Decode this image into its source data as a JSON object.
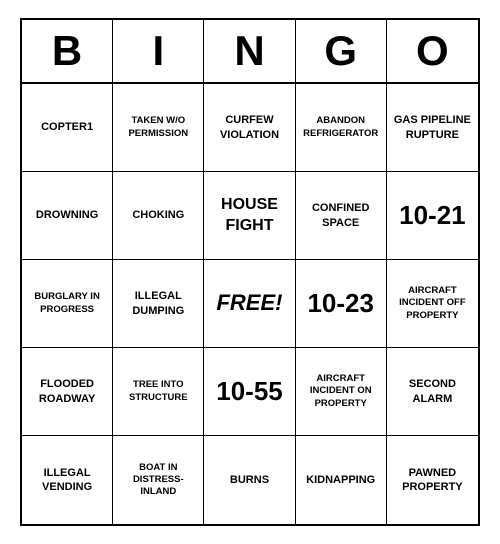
{
  "header": {
    "letters": [
      "B",
      "I",
      "N",
      "G",
      "O"
    ]
  },
  "cells": [
    {
      "text": "COPTER1",
      "size": "normal"
    },
    {
      "text": "TAKEN W/O PERMISSION",
      "size": "small"
    },
    {
      "text": "CURFEW VIOLATION",
      "size": "normal"
    },
    {
      "text": "ABANDON REFRIGERATOR",
      "size": "small"
    },
    {
      "text": "GAS PIPELINE RUPTURE",
      "size": "normal"
    },
    {
      "text": "DROWNING",
      "size": "normal"
    },
    {
      "text": "CHOKING",
      "size": "normal"
    },
    {
      "text": "HOUSE FIGHT",
      "size": "large-normal"
    },
    {
      "text": "CONFINED SPACE",
      "size": "normal"
    },
    {
      "text": "10-21",
      "size": "large"
    },
    {
      "text": "BURGLARY IN PROGRESS",
      "size": "small"
    },
    {
      "text": "ILLEGAL DUMPING",
      "size": "normal"
    },
    {
      "text": "Free!",
      "size": "free"
    },
    {
      "text": "10-23",
      "size": "large"
    },
    {
      "text": "AIRCRAFT INCIDENT OFF PROPERTY",
      "size": "small"
    },
    {
      "text": "FLOODED ROADWAY",
      "size": "normal"
    },
    {
      "text": "TREE INTO STRUCTURE",
      "size": "small"
    },
    {
      "text": "10-55",
      "size": "large"
    },
    {
      "text": "AIRCRAFT INCIDENT ON PROPERTY",
      "size": "small"
    },
    {
      "text": "SECOND ALARM",
      "size": "normal"
    },
    {
      "text": "ILLEGAL VENDING",
      "size": "normal"
    },
    {
      "text": "BOAT IN DISTRESS-INLAND",
      "size": "small"
    },
    {
      "text": "BURNS",
      "size": "normal"
    },
    {
      "text": "KIDNAPPING",
      "size": "normal"
    },
    {
      "text": "PAWNED PROPERTY",
      "size": "normal"
    }
  ]
}
